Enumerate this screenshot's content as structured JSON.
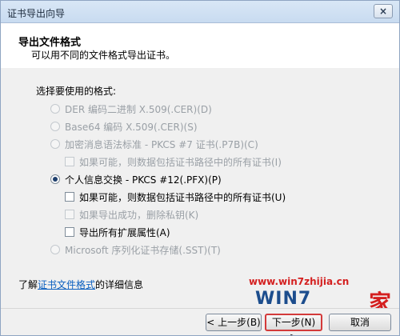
{
  "window": {
    "title": "证书导出向导",
    "close_glyph": "×"
  },
  "header": {
    "title": "导出文件格式",
    "subtitle": "可以用不同的文件格式导出证书。"
  },
  "content": {
    "section_label": "选择要使用的格式:",
    "options": [
      {
        "label": "DER 编码二进制 X.509(.CER)(D)"
      },
      {
        "label": "Base64 编码 X.509(.CER)(S)"
      },
      {
        "label": "加密消息语法标准 - PKCS #7 证书(.P7B)(C)"
      },
      {
        "label": "如果可能，则数据包括证书路径中的所有证书(I)"
      },
      {
        "label": "个人信息交换 - PKCS #12(.PFX)(P)"
      },
      {
        "label": "如果可能，则数据包括证书路径中的所有证书(U)"
      },
      {
        "label": "如果导出成功，删除私钥(K)"
      },
      {
        "label": "导出所有扩展属性(A)"
      },
      {
        "label": "Microsoft 序列化证书存储(.SST)(T)"
      }
    ],
    "learn_prefix": "了解",
    "learn_link": "证书文件格式",
    "learn_suffix": "的详细信息"
  },
  "buttons": {
    "back": "< 上一步(B)",
    "next": "下一步(N) >",
    "cancel": "取消"
  },
  "watermark": {
    "url": "www.win7zhijia.cn",
    "logo": "WIN7",
    "jia": "家"
  }
}
